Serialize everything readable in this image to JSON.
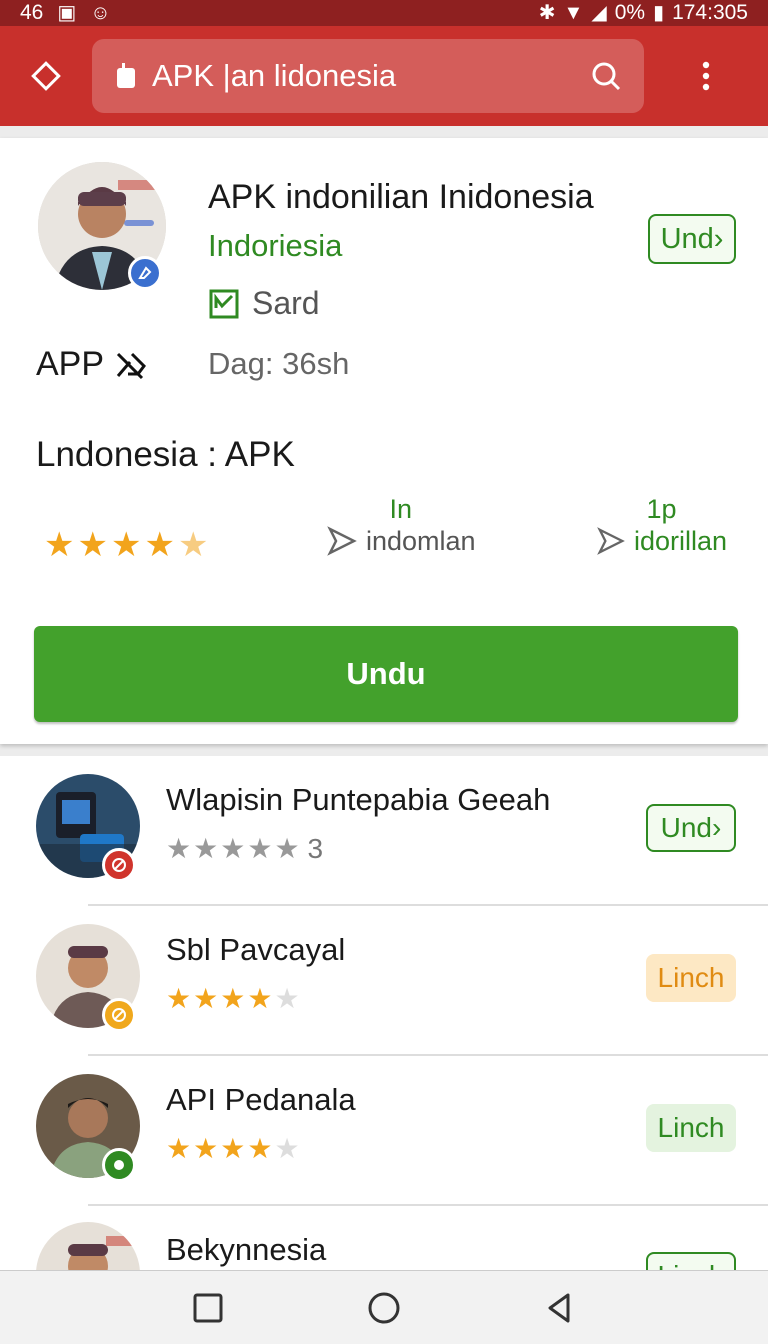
{
  "status": {
    "left_num": "46",
    "right_pct": "0%",
    "time": "174:305"
  },
  "toolbar": {
    "search_text": "APK |an lidonesia"
  },
  "app": {
    "title": "APK indonilian Inidonesia",
    "developer": "Indoriesia",
    "category": "Sard",
    "app_label": "APP",
    "downloads": "Dag: 36sh",
    "action_label": "Und›",
    "subtitle": "Lndonesia : APK",
    "rating_stars": 4.5,
    "stat1_top": "In",
    "stat1_bottom": "indomlan",
    "stat2_top": "1p",
    "stat2_bottom": "idorillan",
    "install_label": "Undu"
  },
  "list": [
    {
      "name": "Wlapisin Puntepabia Geeah",
      "rating": 0,
      "rating_text": "3",
      "action": "Und›",
      "badge": "red"
    },
    {
      "name": "Sbl Pavcayal",
      "rating": 4,
      "rating_text": "",
      "action": "Linch",
      "badge": "orange"
    },
    {
      "name": "API Pedanala",
      "rating": 4,
      "rating_text": "",
      "action": "Linch",
      "badge": "green"
    },
    {
      "name": "Bekynnesia",
      "rating": 0,
      "rating_text": "",
      "action": "Linch",
      "badge": ""
    }
  ],
  "colors": {
    "toolbar": "#c8302c",
    "accent_green": "#43a12c",
    "star": "#f2a41c"
  }
}
